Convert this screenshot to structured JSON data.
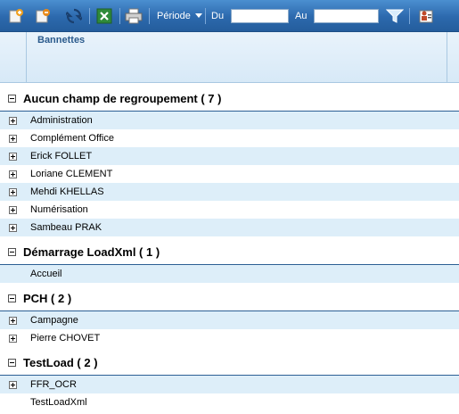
{
  "toolbar": {
    "periode_label": "Période",
    "du_label": "Du",
    "du_value": "",
    "au_label": "Au",
    "au_value": ""
  },
  "header": {
    "column_title": "Bannettes"
  },
  "groups": [
    {
      "title": "Aucun champ de regroupement ( 7 )",
      "rows": [
        {
          "label": "Administration",
          "expandable": true
        },
        {
          "label": "Complément Office",
          "expandable": true
        },
        {
          "label": "Erick FOLLET",
          "expandable": true
        },
        {
          "label": "Loriane CLEMENT",
          "expandable": true
        },
        {
          "label": "Mehdi KHELLAS",
          "expandable": true
        },
        {
          "label": "Numérisation",
          "expandable": true
        },
        {
          "label": "Sambeau PRAK",
          "expandable": true
        }
      ]
    },
    {
      "title": "Démarrage LoadXml ( 1 )",
      "rows": [
        {
          "label": "Accueil",
          "expandable": false
        }
      ]
    },
    {
      "title": "PCH ( 2 )",
      "rows": [
        {
          "label": "Campagne",
          "expandable": true
        },
        {
          "label": "Pierre CHOVET",
          "expandable": true
        }
      ]
    },
    {
      "title": "TestLoad ( 2 )",
      "rows": [
        {
          "label": "FFR_OCR",
          "expandable": true
        },
        {
          "label": "TestLoadXml",
          "expandable": false
        }
      ]
    }
  ]
}
